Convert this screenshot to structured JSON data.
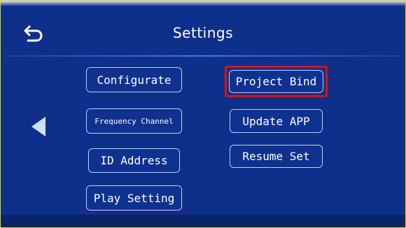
{
  "header": {
    "title": "Settings"
  },
  "buttons": {
    "configurate": "Configurate",
    "frequency_channel": "Frequency Channel",
    "id_address": "ID Address",
    "play_setting": "Play Setting",
    "project_bind": "Project Bind",
    "update_app": "Update APP",
    "resume_set": "Resume Set"
  },
  "selected_button": "Project Bind",
  "colors": {
    "background": "#0e308a",
    "border_highlight": "#f2d600",
    "selection": "#e01010",
    "text": "#ffffff"
  },
  "icons": [
    "back-icon",
    "left-arrow-icon"
  ]
}
